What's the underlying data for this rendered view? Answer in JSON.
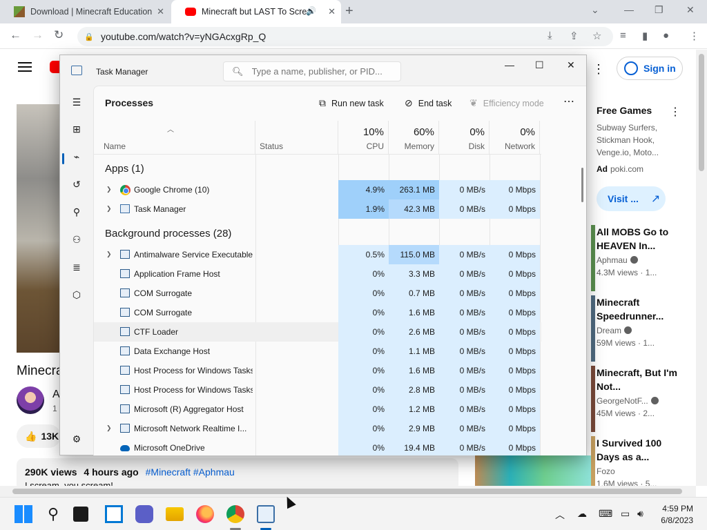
{
  "browser": {
    "tabs": [
      {
        "title": "Download | Minecraft Education",
        "active": false
      },
      {
        "title": "Minecraft but LAST To Scream",
        "active": true
      }
    ],
    "url": "youtube.com/watch?v=yNGAcxgRp_Q"
  },
  "youtube": {
    "sign_in": "Sign in",
    "video_title": "Minecra",
    "channel_initial": "A",
    "subs_partial": "1",
    "likes": "13K",
    "views": "290K views",
    "posted": "4 hours ago",
    "tags": "#Minecraft #Aphmau",
    "desc_line": "I scream, you scream!",
    "ad": {
      "title": "Free Games",
      "desc": "Subway Surfers, Stickman Hook, Venge.io, Moto...",
      "label": "Ad",
      "domain": "poki.com",
      "visit": "Visit ..."
    },
    "recommended": [
      {
        "title": "All MOBS Go to HEAVEN In...",
        "channel": "Aphmau",
        "views": "4.3M views",
        "age": "1..."
      },
      {
        "title": "Minecraft Speedrunner...",
        "channel": "Dream",
        "views": "59M views",
        "age": "1..."
      },
      {
        "title": "Minecraft, But I'm Not...",
        "channel": "GeorgeNotF...",
        "views": "45M views",
        "age": "2..."
      },
      {
        "title": "I Survived 100 Days as a...",
        "channel": "Fozo",
        "views": "1.6M views",
        "age": "5..."
      }
    ]
  },
  "taskmanager": {
    "title": "Task Manager",
    "search_placeholder": "Type a name, publisher, or PID...",
    "page_title": "Processes",
    "commands": {
      "run": "Run new task",
      "end": "End task",
      "eff": "Efficiency mode"
    },
    "columns": {
      "name": "Name",
      "status": "Status",
      "cpu": {
        "pct": "10%",
        "label": "CPU"
      },
      "memory": {
        "pct": "60%",
        "label": "Memory"
      },
      "disk": {
        "pct": "0%",
        "label": "Disk"
      },
      "network": {
        "pct": "0%",
        "label": "Network"
      }
    },
    "apps_group": "Apps (1)",
    "apps": [
      {
        "name": "Google Chrome (10)",
        "cpu": "4.9%",
        "mem": "263.1 MB",
        "disk": "0 MB/s",
        "net": "0 Mbps"
      },
      {
        "name": "Task Manager",
        "cpu": "1.9%",
        "mem": "42.3 MB",
        "disk": "0 MB/s",
        "net": "0 Mbps"
      }
    ],
    "bg_group": "Background processes (28)",
    "background": [
      {
        "name": "Antimalware Service Executable",
        "cpu": "0.5%",
        "mem": "115.0 MB",
        "disk": "0 MB/s",
        "net": "0 Mbps"
      },
      {
        "name": "Application Frame Host",
        "cpu": "0%",
        "mem": "3.3 MB",
        "disk": "0 MB/s",
        "net": "0 Mbps"
      },
      {
        "name": "COM Surrogate",
        "cpu": "0%",
        "mem": "0.7 MB",
        "disk": "0 MB/s",
        "net": "0 Mbps"
      },
      {
        "name": "COM Surrogate",
        "cpu": "0%",
        "mem": "1.6 MB",
        "disk": "0 MB/s",
        "net": "0 Mbps"
      },
      {
        "name": "CTF Loader",
        "cpu": "0%",
        "mem": "2.6 MB",
        "disk": "0 MB/s",
        "net": "0 Mbps"
      },
      {
        "name": "Data Exchange Host",
        "cpu": "0%",
        "mem": "1.1 MB",
        "disk": "0 MB/s",
        "net": "0 Mbps"
      },
      {
        "name": "Host Process for Windows Tasks",
        "cpu": "0%",
        "mem": "1.6 MB",
        "disk": "0 MB/s",
        "net": "0 Mbps"
      },
      {
        "name": "Host Process for Windows Tasks",
        "cpu": "0%",
        "mem": "2.8 MB",
        "disk": "0 MB/s",
        "net": "0 Mbps"
      },
      {
        "name": "Microsoft (R) Aggregator Host",
        "cpu": "0%",
        "mem": "1.2 MB",
        "disk": "0 MB/s",
        "net": "0 Mbps"
      },
      {
        "name": "Microsoft Network Realtime I...",
        "cpu": "0%",
        "mem": "2.9 MB",
        "disk": "0 MB/s",
        "net": "0 Mbps"
      },
      {
        "name": "Microsoft OneDrive",
        "cpu": "0%",
        "mem": "19.4 MB",
        "disk": "0 MB/s",
        "net": "0 Mbps"
      }
    ]
  },
  "taskbar": {
    "time": "4:59 PM",
    "date": "6/8/2023"
  },
  "colors": {
    "accent": "#005fb8",
    "cpu_high": "#9fd0fa",
    "mem_high": "#b5dafc",
    "low": "#dbeefe",
    "youtube_red": "#ff0000"
  }
}
